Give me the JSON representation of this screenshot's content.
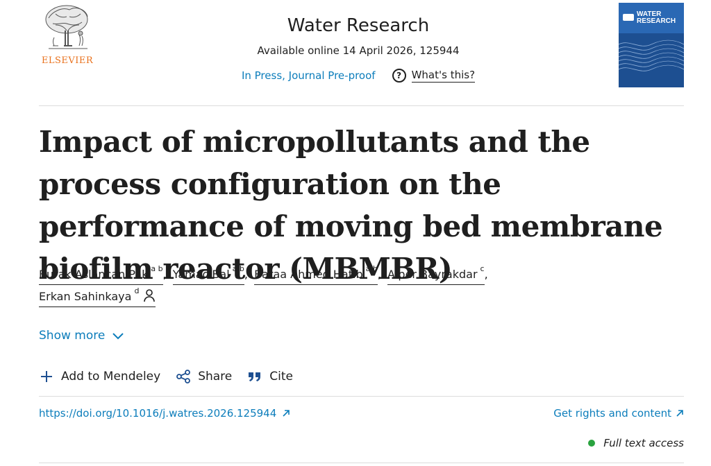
{
  "publisher": {
    "name": "ELSEVIER",
    "accent": "#e9711c"
  },
  "journal": {
    "title": "Water Research",
    "available": "Available online 14 April 2026, 125944",
    "status": "In Press, Journal Pre-proof",
    "whats_this": "What's this?",
    "help_icon": "?",
    "cover": {
      "title_line1": "WATER",
      "title_line2": "RESEARCH",
      "color": "#1d4f91"
    }
  },
  "article": {
    "title": "Impact of micropollutants and the process configuration on the performance of moving bed membrane biofilm reactor (MBMBR)",
    "authors": [
      {
        "name": "Burak Aslancan Pak",
        "sup": "a b",
        "sep": ","
      },
      {
        "name": "Yamac Bal",
        "sup": "a b",
        "sep": ","
      },
      {
        "name": "Baraa Ahmed Hatib",
        "sup": "a b",
        "sep": ","
      },
      {
        "name": "Alper Bayrakdar",
        "sup": "c",
        "sep": ","
      },
      {
        "name": "Erkan Sahinkaya",
        "sup": "d",
        "sep": ""
      }
    ],
    "show_more": "Show more",
    "doi": "https://doi.org/10.1016/j.watres.2026.125944",
    "rights": "Get rights and content",
    "access": "Full text access"
  },
  "actions": {
    "mendeley": "Add to Mendeley",
    "share": "Share",
    "cite": "Cite"
  },
  "colors": {
    "link": "#0c7dbb",
    "access_dot": "#2aa33f",
    "text": "#1f1f1f"
  }
}
